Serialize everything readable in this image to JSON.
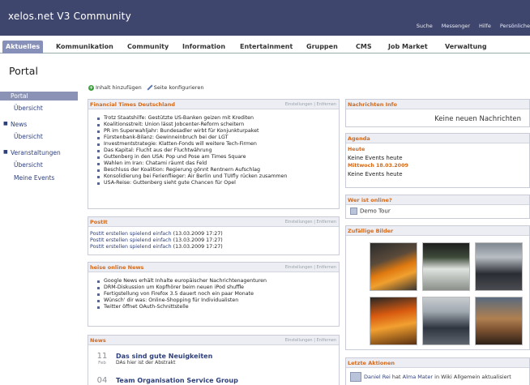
{
  "header": {
    "site_title": "xelos.net V3 Community",
    "links": [
      "Suche",
      "Messenger",
      "Hilfe",
      "Persönliche"
    ]
  },
  "mainnav": {
    "items": [
      "Aktuelles",
      "Kommunikation",
      "Community",
      "Information",
      "Entertainment",
      "Gruppen",
      "CMS",
      "Job Market",
      "Verwaltung"
    ],
    "active": "Aktuelles"
  },
  "page": {
    "heading": "Portal"
  },
  "sidebar": {
    "items": [
      {
        "label": "Portal",
        "active": true
      },
      {
        "label": "Übersicht"
      },
      {
        "label": "News"
      },
      {
        "label": "Übersicht"
      },
      {
        "label": "Veranstaltungen"
      },
      {
        "label": "Übersicht"
      },
      {
        "label": "Meine Events"
      }
    ]
  },
  "toolbar": {
    "add_label": "Inhalt hinzufügen",
    "configure_label": "Seite konfigurieren"
  },
  "box_links": {
    "settings": "Einstellungen",
    "separator": "|",
    "remove": "Entfernen"
  },
  "ft": {
    "title": "Financial Times Deutschland",
    "items": [
      "Trotz Staatshilfe: Gestützte US-Banken geizen mit Krediten",
      "Koalitionsstreit: Union lässt Jobcenter-Reform scheitern",
      "PR im Superwahljahr: Bundesadler wirbt für Konjunkturpaket",
      "Fürstenbank-Bilanz: Gewinneinbruch bei der LGT",
      "Investmentstrategie: Klatten-Fonds will weitere Tech-Firmen",
      "Das Kapital: Flucht aus der Fluchtwährung",
      "Guttenberg in den USA: Pop und Pose am Times Square",
      "Wahlen im Iran: Chatami räumt das Feld",
      "Beschluss der Koalition: Regierung gönnt Rentnern Aufschlag",
      "Konsolidierung bei Ferienflieger: Air Berlin und TUIfly rücken zusammen",
      "USA-Reise: Guttenberg sieht gute Chancen für Opel"
    ]
  },
  "postit": {
    "title": "PostIt",
    "items": [
      {
        "text": "PostIt erstellen spielend einfach",
        "date": "(13.03.2009 17:27)"
      },
      {
        "text": "PostIt erstellen spielend einfach",
        "date": "(13.03.2009 17:27)"
      },
      {
        "text": "PostIt erstellen spielend einfach",
        "date": "(13.03.2009 17:27)"
      }
    ]
  },
  "heise": {
    "title": "heise online News",
    "items": [
      "Google News erhält Inhalte europäischer Nachrichtenagenturen",
      "DRM-Diskussion um Kopfhörer beim neuen iPod shuffle",
      "Fertigstellung von Firefox 3.5 dauert noch ein paar Monate",
      "Wünsch' dir was: Online-Shopping für Individualisten",
      "Twitter öffnet OAuth-Schnittstelle"
    ]
  },
  "news": {
    "title": "News",
    "items": [
      {
        "day": "11",
        "month": "Feb",
        "title": "Das sind gute Neuigkeiten",
        "sub": "DAs hier ist der Abstrakt"
      },
      {
        "day": "04",
        "month": "",
        "title": "Team Organisation Service Group",
        "sub": ""
      }
    ]
  },
  "messages": {
    "title": "Nachrichten Info",
    "empty": "Keine neuen Nachrichten"
  },
  "agenda": {
    "title": "Agenda",
    "days": [
      {
        "date": "Heute",
        "text": "Keine Events heute"
      },
      {
        "date": "Mittwoch 18.03.2009",
        "text": "Keine Events heute"
      }
    ]
  },
  "online": {
    "title": "Wer ist online?",
    "user": "Demo Tour"
  },
  "images": {
    "title": "Zufällige Bilder"
  },
  "actions": {
    "title": "Letzte Aktionen",
    "user": "Daniel Rei",
    "verb": "hat",
    "target": "Alma Mater",
    "rest": "in Wiki Allgemein aktualisiert"
  }
}
